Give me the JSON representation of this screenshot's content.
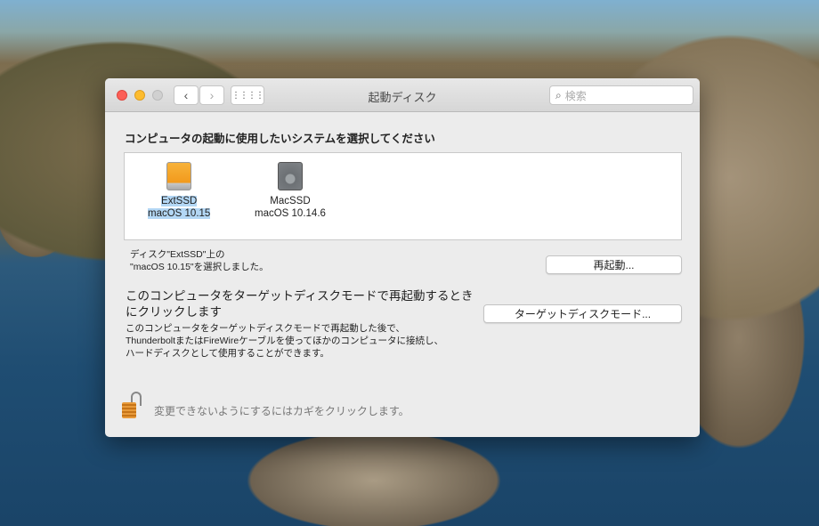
{
  "window": {
    "title": "起動ディスク",
    "search_placeholder": "検索"
  },
  "heading": "コンピュータの起動に使用したいシステムを選択してください",
  "disks": [
    {
      "name": "ExtSSD",
      "os": "macOS 10.15",
      "selected": true,
      "icon": "external-drive-icon",
      "color": "#f5a623"
    },
    {
      "name": "MacSSD",
      "os": "macOS 10.14.6",
      "selected": false,
      "icon": "internal-hdd-icon",
      "color": "#8a8d90"
    }
  ],
  "status": {
    "line1": "ディスク\"ExtSSD\"上の",
    "line2": "\"macOS 10.15\"を選択しました。"
  },
  "restart_button": "再起動...",
  "target_mode": {
    "title_line1": "このコンピュータをターゲットディスクモードで再起動するとき",
    "title_line2": "にクリックします",
    "desc_line1": "このコンピュータをターゲットディスクモードで再起動した後で、",
    "desc_line2": "ThunderboltまたはFireWireケーブルを使ってほかのコンピュータに接続し、",
    "desc_line3": "ハードディスクとして使用することができます。",
    "button": "ターゲットディスクモード..."
  },
  "lock_text": "変更できないようにするにはカギをクリックします。"
}
